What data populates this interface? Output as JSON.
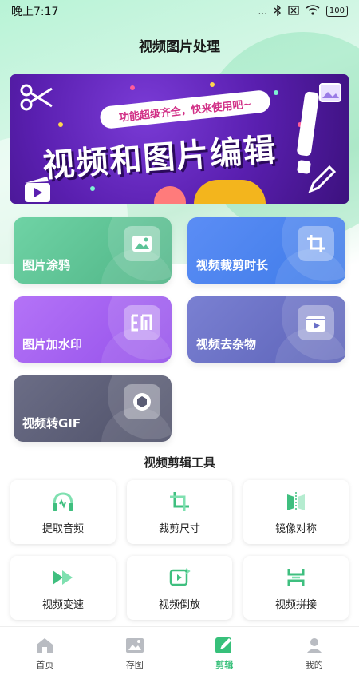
{
  "status_bar": {
    "time": "晚上7:17",
    "signal": "...",
    "battery": "100"
  },
  "app": {
    "title": "视频图片处理"
  },
  "banner": {
    "tagline": "功能超级齐全，快来使用吧~",
    "headline": "视频和图片编辑"
  },
  "features": [
    {
      "label": "图片涂鸦",
      "icon": "image-icon"
    },
    {
      "label": "视频裁剪时长",
      "icon": "crop-icon"
    },
    {
      "label": "图片加水印",
      "icon": "watermark-icon"
    },
    {
      "label": "视频去杂物",
      "icon": "video-play-icon"
    },
    {
      "label": "视频转GIF",
      "icon": "aperture-icon"
    }
  ],
  "tools_section": {
    "title": "视频剪辑工具",
    "items": [
      {
        "label": "提取音频",
        "icon": "headphones-icon"
      },
      {
        "label": "裁剪尺寸",
        "icon": "crop-size-icon"
      },
      {
        "label": "镜像对称",
        "icon": "mirror-icon"
      },
      {
        "label": "视频变速",
        "icon": "fast-forward-icon"
      },
      {
        "label": "视频倒放",
        "icon": "reverse-play-icon"
      },
      {
        "label": "视频拼接",
        "icon": "merge-icon"
      }
    ]
  },
  "tabs": [
    {
      "label": "首页",
      "icon": "home-icon",
      "active": false
    },
    {
      "label": "存图",
      "icon": "gallery-icon",
      "active": false
    },
    {
      "label": "剪辑",
      "icon": "edit-icon",
      "active": true
    },
    {
      "label": "我的",
      "icon": "user-icon",
      "active": false
    }
  ],
  "colors": {
    "accent": "#37c07a",
    "banner_bg": "#5a1fb0"
  }
}
